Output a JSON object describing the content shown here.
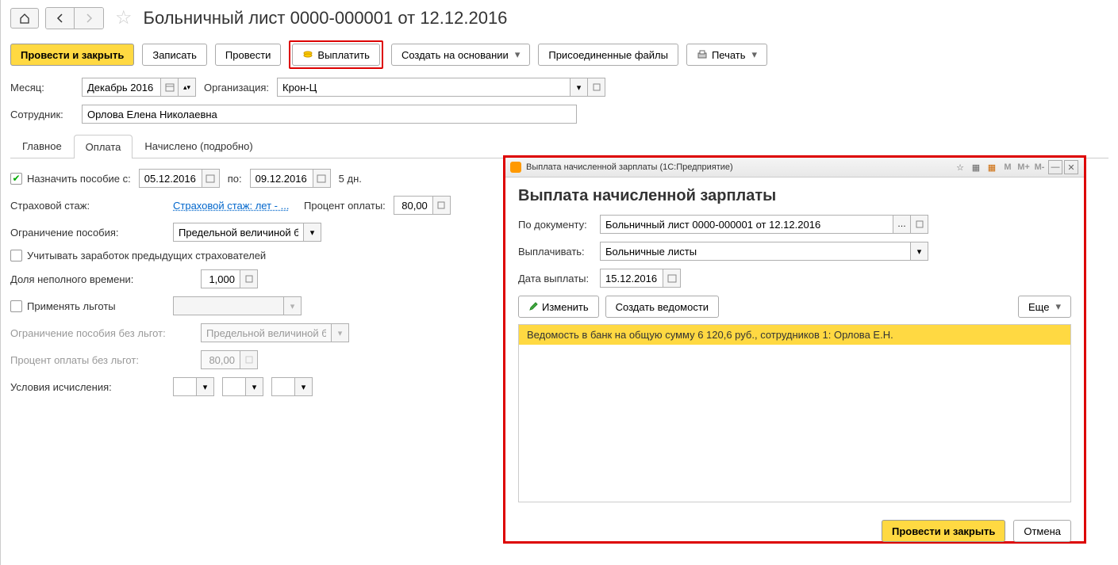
{
  "header": {
    "title": "Больничный лист 0000-000001 от 12.12.2016"
  },
  "toolbar": {
    "post_and_close": "Провести и закрыть",
    "save": "Записать",
    "post": "Провести",
    "pay": "Выплатить",
    "create_based": "Создать на основании",
    "attached_files": "Присоединенные файлы",
    "print": "Печать"
  },
  "form": {
    "month_label": "Месяц:",
    "month_value": "Декабрь 2016",
    "org_label": "Организация:",
    "org_value": "Крон-Ц",
    "employee_label": "Сотрудник:",
    "employee_value": "Орлова Елена Николаевна"
  },
  "tabs": {
    "main": "Главное",
    "payment": "Оплата",
    "accrued": "Начислено (подробно)"
  },
  "payment": {
    "assign_benefit_label": "Назначить пособие с:",
    "date_from": "05.12.2016",
    "date_to_label": "по:",
    "date_to": "09.12.2016",
    "days": "5 дн.",
    "insurance_label": "Страховой стаж:",
    "insurance_link": "Страховой стаж: лет - ...",
    "pay_percent_label": "Процент оплаты:",
    "pay_percent": "80,00",
    "limit_label": "Ограничение пособия:",
    "limit_value": "Предельной величиной ба",
    "prev_insurers_label": "Учитывать заработок предыдущих страхователей",
    "part_time_label": "Доля неполного времени:",
    "part_time_value": "1,000",
    "apply_benefits_label": "Применять льготы",
    "limit_no_benefits_label": "Ограничение пособия без льгот:",
    "limit_no_benefits_value": "Предельной величиной ба",
    "percent_no_benefits_label": "Процент оплаты без льгот:",
    "percent_no_benefits_value": "80,00",
    "calc_conditions_label": "Условия исчисления:"
  },
  "popup": {
    "titlebar": "Выплата начисленной зарплаты  (1С:Предприятие)",
    "title": "Выплата начисленной зарплаты",
    "by_doc_label": "По документу:",
    "by_doc_value": "Больничный лист 0000-000001 от 12.12.2016",
    "pay_label": "Выплачивать:",
    "pay_value": "Больничные листы",
    "pay_date_label": "Дата выплаты:",
    "pay_date_value": "15.12.2016",
    "edit_btn": "Изменить",
    "create_sheets_btn": "Создать ведомости",
    "more_btn": "Еще",
    "list_row": "Ведомость в банк на общую сумму 6 120,6 руб., сотрудников 1: Орлова Е.Н.",
    "post_close_btn": "Провести  и закрыть",
    "cancel_btn": "Отмена",
    "tb_m": "M",
    "tb_mp": "M+",
    "tb_mm": "M-"
  }
}
